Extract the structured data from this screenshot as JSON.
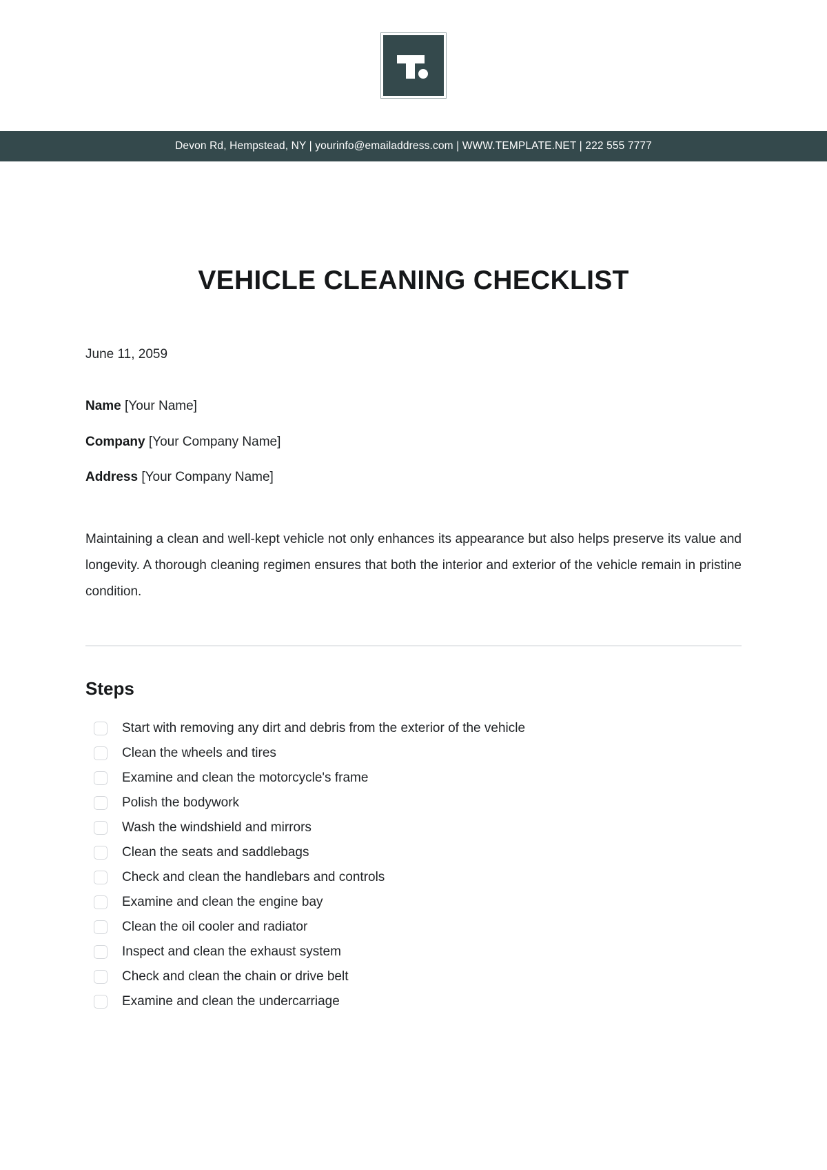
{
  "brand": {
    "logo_letter": "T",
    "logo_icon": "template-net-logo"
  },
  "contact_bar": {
    "text": "Devon Rd, Hempstead, NY | yourinfo@emailaddress.com | WWW.TEMPLATE.NET | 222 555 7777",
    "background_color": "#34494c",
    "text_color": "#ffffff"
  },
  "document": {
    "title": "VEHICLE CLEANING CHECKLIST",
    "date": "June 11, 2059",
    "fields": [
      {
        "label": "Name",
        "value": "[Your Name]"
      },
      {
        "label": "Company",
        "value": "[Your Company Name]"
      },
      {
        "label": "Address",
        "value": "[Your Company Name]"
      }
    ],
    "intro": "Maintaining a clean and well-kept vehicle not only enhances its appearance but also helps preserve its value and longevity. A thorough cleaning regimen ensures that both the interior and exterior of the vehicle remain in pristine condition.",
    "section_heading": "Steps",
    "steps": [
      "Start with removing any dirt and debris from the exterior of the vehicle",
      "Clean the wheels and tires",
      "Examine and clean the motorcycle's frame",
      "Polish the bodywork",
      "Wash the windshield and mirrors",
      "Clean the seats and saddlebags",
      "Check and clean the handlebars and controls",
      "Examine and clean the engine bay",
      "Clean the oil cooler and radiator",
      "Inspect and clean the exhaust system",
      "Check and clean the chain or drive belt",
      "Examine and clean the undercarriage"
    ]
  }
}
